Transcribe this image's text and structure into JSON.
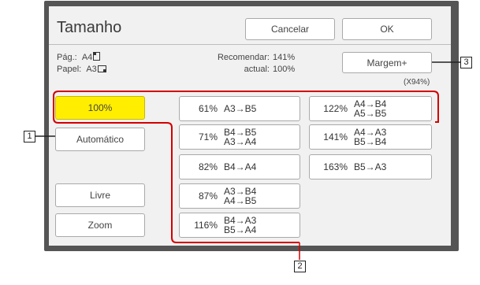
{
  "dialog": {
    "title": "Tamanho",
    "cancel_label": "Cancelar",
    "ok_label": "OK"
  },
  "info": {
    "page_label": "Pág.:",
    "page_size": "A4",
    "paper_label": "Papel:",
    "paper_size": "A3",
    "recommended_label": "Recomendar:",
    "recommended_value": "141%",
    "current_label": "actual:",
    "current_value": "100%"
  },
  "margin_button": "Margem+",
  "margin_factor": "(X94%)",
  "left_buttons": {
    "hundred": "100%",
    "auto": "Automático",
    "free": "Livre",
    "zoom": "Zoom"
  },
  "ratios": [
    {
      "pct": "61%",
      "lines": [
        "A3→B5"
      ]
    },
    {
      "pct": "71%",
      "lines": [
        "B4→B5",
        "A3→A4"
      ]
    },
    {
      "pct": "82%",
      "lines": [
        "B4→A4"
      ]
    },
    {
      "pct": "87%",
      "lines": [
        "A3→B4",
        "A4→B5"
      ]
    },
    {
      "pct": "116%",
      "lines": [
        "B4→A3",
        "B5→A4"
      ]
    },
    {
      "pct": "122%",
      "lines": [
        "A4→B4",
        "A5→B5"
      ]
    },
    {
      "pct": "141%",
      "lines": [
        "A4→A3",
        "B5→B4"
      ]
    },
    {
      "pct": "163%",
      "lines": [
        "B5→A3"
      ]
    }
  ],
  "callouts": [
    "1",
    "2",
    "3"
  ],
  "colors": {
    "selected": "#ffee00",
    "callout_line": "#d40000"
  }
}
